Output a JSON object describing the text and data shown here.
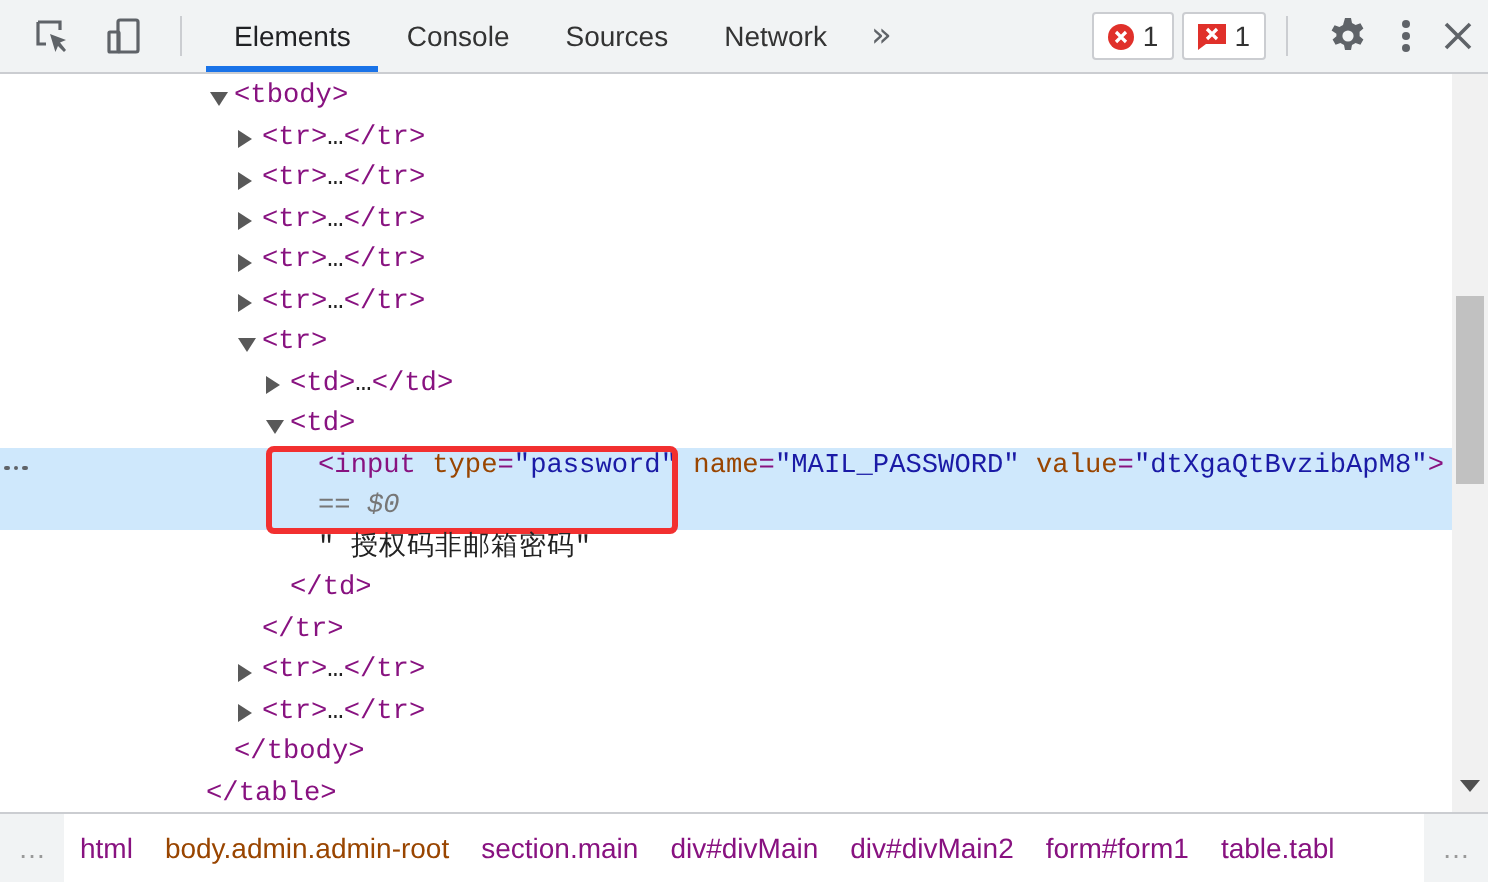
{
  "toolbar": {
    "tabs": [
      {
        "label": "Elements",
        "selected": true
      },
      {
        "label": "Console",
        "selected": false
      },
      {
        "label": "Sources",
        "selected": false
      },
      {
        "label": "Network",
        "selected": false
      }
    ],
    "more_tabs": "»",
    "badges": [
      {
        "kind": "error",
        "count": "1"
      },
      {
        "kind": "issue",
        "count": "1"
      }
    ]
  },
  "dom_tree": {
    "root": {
      "close": "</table>",
      "children": [
        {
          "open": "<tbody>",
          "close": "</tbody>",
          "expanded": true,
          "children": [
            {
              "open": "<tr>",
              "close": "</tr>",
              "expanded": false,
              "ellipsis": "…"
            },
            {
              "open": "<tr>",
              "close": "</tr>",
              "expanded": false,
              "ellipsis": "…"
            },
            {
              "open": "<tr>",
              "close": "</tr>",
              "expanded": false,
              "ellipsis": "…"
            },
            {
              "open": "<tr>",
              "close": "</tr>",
              "expanded": false,
              "ellipsis": "…"
            },
            {
              "open": "<tr>",
              "close": "</tr>",
              "expanded": false,
              "ellipsis": "…"
            },
            {
              "open": "<tr>",
              "close": "</tr>",
              "expanded": true,
              "children": [
                {
                  "open": "<td>",
                  "close": "</td>",
                  "expanded": false,
                  "ellipsis": "…"
                },
                {
                  "open": "<td>",
                  "close": "</td>",
                  "expanded": true,
                  "children": [
                    {
                      "kind": "element",
                      "selected": true,
                      "annotated": true,
                      "tokens": [
                        {
                          "kind": "tag",
                          "text": "<input"
                        },
                        {
                          "kind": "attr",
                          "text": " type"
                        },
                        {
                          "kind": "punct",
                          "text": "="
                        },
                        {
                          "kind": "value",
                          "text": "\"password\""
                        },
                        {
                          "kind": "attr",
                          "text": " name"
                        },
                        {
                          "kind": "punct",
                          "text": "="
                        },
                        {
                          "kind": "value",
                          "text": "\"MAIL_PASSWORD\""
                        },
                        {
                          "kind": "attr",
                          "text": " value"
                        },
                        {
                          "kind": "punct",
                          "text": "="
                        },
                        {
                          "kind": "value",
                          "text": "\"dtXgaQtBvzibApM8\""
                        },
                        {
                          "kind": "tag",
                          "text": ">"
                        }
                      ],
                      "note": "== $0"
                    },
                    {
                      "kind": "text",
                      "selected": false,
                      "text": "\" 授权码非邮箱密码\""
                    }
                  ]
                }
              ]
            },
            {
              "open": "<tr>",
              "close": "</tr>",
              "expanded": false,
              "ellipsis": "…"
            },
            {
              "open": "<tr>",
              "close": "</tr>",
              "expanded": false,
              "ellipsis": "…"
            }
          ]
        }
      ]
    }
  },
  "breadcrumbs": {
    "overflow_left": "…",
    "overflow_right": "…",
    "items": [
      {
        "text": "html",
        "color": "#881280"
      },
      {
        "text": "body.admin.admin-root",
        "color": "#994500"
      },
      {
        "text": "section.main",
        "color": "#881280"
      },
      {
        "text": "div#divMain",
        "color": "#881280"
      },
      {
        "text": "div#divMain2",
        "color": "#881280"
      },
      {
        "text": "form#form1",
        "color": "#881280"
      },
      {
        "text": "table.tabl",
        "color": "#881280"
      }
    ]
  }
}
